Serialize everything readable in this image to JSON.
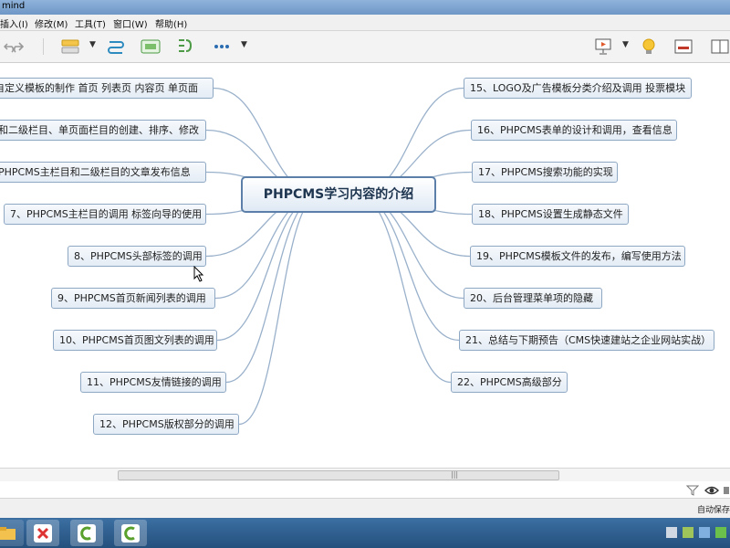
{
  "window": {
    "title": "mind"
  },
  "menu": [
    "插入(I)",
    "修改(M)",
    "工具(T)",
    "窗口(W)",
    "帮助(H)"
  ],
  "central_topic": "PHPCMS学习内容的介绍",
  "left_topics": [
    "S自定义模板的制作 首页 列表页 内容页 单页面",
    "目和二级栏目、单页面栏目的创建、排序、修改",
    "、PHPCMS主栏目和二级栏目的文章发布信息",
    "7、PHPCMS主栏目的调用 标签向导的使用",
    "8、PHPCMS头部标签的调用",
    "9、PHPCMS首页新闻列表的调用",
    "10、PHPCMS首页图文列表的调用",
    "11、PHPCMS友情链接的调用",
    "12、PHPCMS版权部分的调用"
  ],
  "right_topics": [
    "15、LOGO及广告模板分类介绍及调用 投票模块",
    "16、PHPCMS表单的设计和调用，查看信息",
    "17、PHPCMS搜索功能的实现",
    "18、PHPCMS设置生成静态文件",
    "19、PHPCMS模板文件的发布，编写使用方法",
    "20、后台管理菜单项的隐藏",
    "21、总结与下期预告（CMS快速建站之企业网站实战）",
    "22、PHPCMS高级部分"
  ],
  "status": {
    "autosave": "自动保存"
  },
  "colors": {
    "node_border": "#8ea8c4",
    "branch_line": "#9ab1cb",
    "central_border": "#5b7fa8"
  },
  "icons": [
    "undo-icon",
    "redo-icon",
    "topic-icon",
    "relationship-icon",
    "boundary-icon",
    "summary-icon",
    "more-icon",
    "presentation-icon",
    "idea-icon",
    "panel-icon",
    "filter-icon",
    "eye-icon"
  ]
}
